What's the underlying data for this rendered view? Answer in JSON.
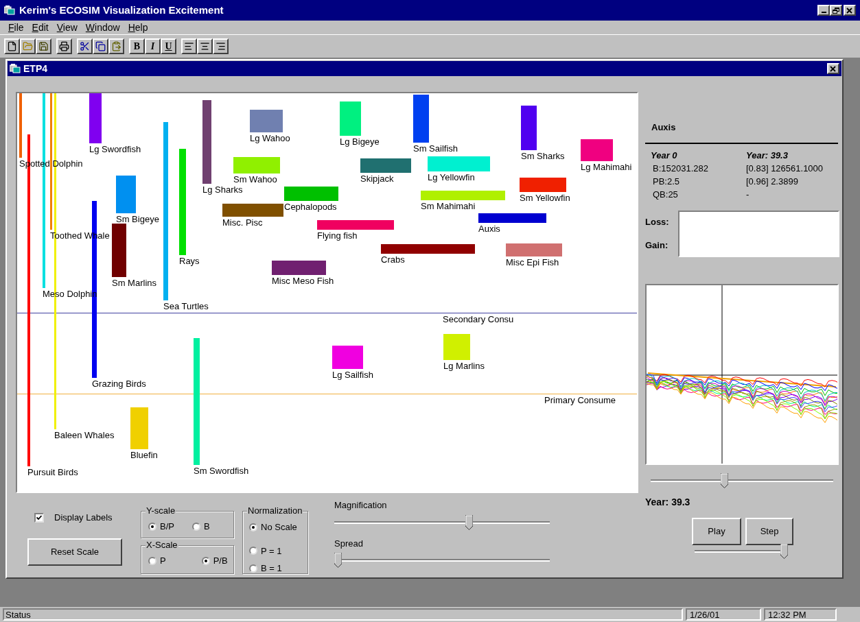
{
  "window": {
    "title": "Kerim's ECOSIM Visualization Excitement"
  },
  "menu": [
    "File",
    "Edit",
    "View",
    "Window",
    "Help"
  ],
  "toolbar_text_buttons": [
    "B",
    "I",
    "U"
  ],
  "child_window": {
    "title": "ETP4"
  },
  "plot": {
    "groups": [
      {
        "label": "Lg Wahoo",
        "color": "#7080b0"
      },
      {
        "label": "Lg Bigeye",
        "color": "#00f080"
      },
      {
        "label": "Lg Swordfish",
        "color": "#8000f0"
      },
      {
        "label": "Sm Sailfish",
        "color": "#0040f0"
      },
      {
        "label": "Sm Sharks",
        "color": "#5000f0"
      },
      {
        "label": "Spotted Dolphin",
        "color": "#f06000"
      },
      {
        "label": "Lg Mahimahi",
        "color": "#f00080"
      },
      {
        "label": "Sm Wahoo",
        "color": "#90f000"
      },
      {
        "label": "Skipjack",
        "color": "#207070"
      },
      {
        "label": "Lg Yellowfin",
        "color": "#00f0d0"
      },
      {
        "label": "Lg Sharks",
        "color": "#704070"
      },
      {
        "label": "Sm Yellowfin",
        "color": "#f02000"
      },
      {
        "label": "Cephalopods",
        "color": "#00c000"
      },
      {
        "label": "Sm Mahimahi",
        "color": "#b0f000"
      },
      {
        "label": "Sm Bigeye",
        "color": "#0090f0"
      },
      {
        "label": "Misc. Pisc",
        "color": "#805000"
      },
      {
        "label": "Auxis",
        "color": "#0000d0"
      },
      {
        "label": "Toothed Whale",
        "color": "#f08000"
      },
      {
        "label": "Flying fish",
        "color": "#f00060"
      },
      {
        "label": "Rays",
        "color": "#00e000"
      },
      {
        "label": "Crabs",
        "color": "#900000"
      },
      {
        "label": "Misc Epi Fish",
        "color": "#d07070"
      },
      {
        "label": "Sm Marlins",
        "color": "#700000"
      },
      {
        "label": "Misc Meso Fish",
        "color": "#702070"
      },
      {
        "label": "Meso Dolphin",
        "color": "#00e0e0"
      },
      {
        "label": "Sea Turtles",
        "color": "#00b0f0"
      },
      {
        "label": "Lg Marlins",
        "color": "#d0f000"
      },
      {
        "label": "Lg Sailfish",
        "color": "#f000e0"
      },
      {
        "label": "Grazing Birds",
        "color": "#0000f0"
      },
      {
        "label": "Baleen Whales",
        "color": "#f0f000"
      },
      {
        "label": "Bluefin",
        "color": "#f0d000"
      },
      {
        "label": "Pursuit Birds",
        "color": "#ff0000"
      },
      {
        "label": "Sm Swordfish",
        "color": "#00f0a0"
      }
    ],
    "levels": [
      {
        "label": "Secondary Consu",
        "color": "#4040a0"
      },
      {
        "label": "Primary Consume",
        "color": "#f0b040"
      }
    ]
  },
  "controls": {
    "display_labels": {
      "label": "Display Labels",
      "checked": true
    },
    "reset_button": "Reset Scale",
    "y_scale": {
      "title": "Y-scale",
      "options": [
        {
          "label": "B/P",
          "selected": true
        },
        {
          "label": "B",
          "selected": false
        }
      ]
    },
    "x_scale": {
      "title": "X-Scale",
      "options": [
        {
          "label": "P",
          "selected": false
        },
        {
          "label": "P/B",
          "selected": true
        }
      ]
    },
    "normalization": {
      "title": "Normalization",
      "options": [
        {
          "label": "No Scale",
          "selected": true
        },
        {
          "label": "P = 1",
          "selected": false
        },
        {
          "label": "B = 1",
          "selected": false
        }
      ]
    },
    "magnification": {
      "label": "Magnification",
      "level": 0.63
    },
    "spread": {
      "label": "Spread",
      "level": 0
    }
  },
  "details": {
    "group": "Auxis",
    "headers": [
      "Year 0",
      "Year: 39.3"
    ],
    "rows": [
      [
        "B:152031.282",
        "[0.83] 126561.1000"
      ],
      [
        "PB:2.5",
        "[0.96] 2.3899"
      ],
      [
        "QB:25",
        "-"
      ]
    ],
    "loss_label": "Loss:",
    "gain_label": "Gain:"
  },
  "timeline": {
    "level": 0.4,
    "year_label": "Year: 39.3",
    "play": "Play",
    "step": "Step",
    "speed": {
      "level": 1
    }
  },
  "status_bar": [
    "Status",
    "1/26/01",
    "12:32 PM"
  ]
}
